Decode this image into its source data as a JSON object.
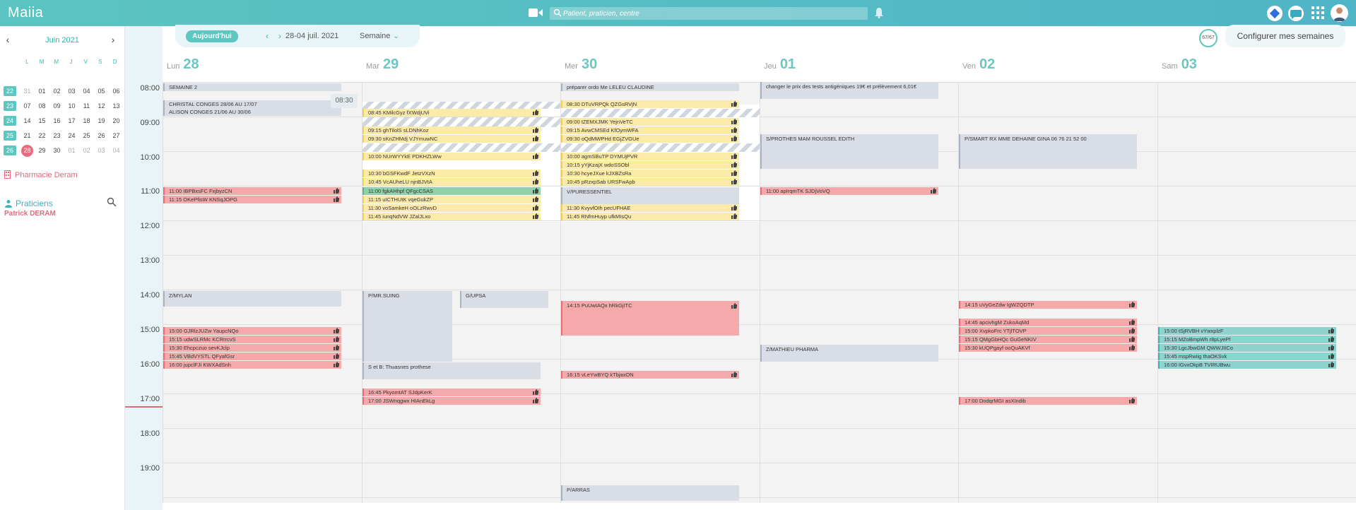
{
  "app": {
    "title": "Maiia"
  },
  "search": {
    "placeholder": "Patient, praticien, centre"
  },
  "mini_calendar": {
    "month": "Juin 2021",
    "dow": [
      "L",
      "M",
      "M",
      "J",
      "V",
      "S",
      "D"
    ],
    "weeks": [
      {
        "num": "22",
        "days": [
          "31",
          "01",
          "02",
          "03",
          "04",
          "05",
          "06"
        ]
      },
      {
        "num": "23",
        "days": [
          "07",
          "08",
          "09",
          "10",
          "11",
          "12",
          "13"
        ]
      },
      {
        "num": "24",
        "days": [
          "14",
          "15",
          "16",
          "17",
          "18",
          "19",
          "20"
        ]
      },
      {
        "num": "25",
        "days": [
          "21",
          "22",
          "23",
          "24",
          "25",
          "26",
          "27"
        ]
      },
      {
        "num": "26",
        "days": [
          "28",
          "29",
          "30",
          "01",
          "02",
          "03",
          "04"
        ]
      }
    ]
  },
  "sidebar": {
    "pharmacy": "Pharmacie Deram",
    "practitioners_title": "Praticiens",
    "practitioner": "Patrick DERAM"
  },
  "toolbar": {
    "today": "Aujourd'hui",
    "date_range": "28-04 juil. 2021",
    "view": "Semaine",
    "counter": "67/67",
    "configure": "Configurer mes semaines"
  },
  "tooltip": "08:30",
  "days": [
    {
      "label": "Lun",
      "num": "28"
    },
    {
      "label": "Mar",
      "num": "29"
    },
    {
      "label": "Mer",
      "num": "30"
    },
    {
      "label": "Jeu",
      "num": "01"
    },
    {
      "label": "Ven",
      "num": "02"
    },
    {
      "label": "Sam",
      "num": "03"
    }
  ],
  "hours": [
    "08:00",
    "09:00",
    "10:00",
    "11:00",
    "12:00",
    "13:00",
    "14:00",
    "15:00",
    "16:00",
    "17:00",
    "18:00",
    "19:00"
  ],
  "events": {
    "mon": [
      {
        "t": "SEMAINE 2"
      },
      {
        "t": "CHRISTAL CONGES 28/06 AU 17/07"
      },
      {
        "t": "ALISON CONGES 21/06 AU 30/06"
      },
      {
        "t": "11:00 IBPBxsFC FxjbyzCN"
      },
      {
        "t": "11:15 OKePfisW KNSqJOPG"
      },
      {
        "t": "Z/MYLAN"
      },
      {
        "t": "15:00 GJRlzJUZw YaupcNQo"
      },
      {
        "t": "15:15 udwSLRMc KCRrrcvS"
      },
      {
        "t": "15:30 Ehcpczuo sevKJclp"
      },
      {
        "t": "15:45 VBdVYSTL QFyafGsr"
      },
      {
        "t": "16:00 jupclFJi KWXAdSnh"
      }
    ],
    "tue": [
      {
        "t": "08:45 KMilcGyz fXWdjUVi"
      },
      {
        "t": "09:15 ghTilolS sLDNhKoz"
      },
      {
        "t": "09:30 sKnZHMdj VJYmuwNC"
      },
      {
        "t": "10:00 NUrWYYkE PDKHZLWw"
      },
      {
        "t": "10:30 bGSFKwdF JetzVXzN"
      },
      {
        "t": "10:45 VcAUheLU njnBJVtA"
      },
      {
        "t": "11:00 fgkAHhpf QFgcCSAS"
      },
      {
        "t": "11:15 uICTHUtK vqeGukZP"
      },
      {
        "t": "11:30 voSamkeH oOLzRwvD"
      },
      {
        "t": "11:45 iunqNdVW JZalJLxo"
      },
      {
        "t": "P/MR.SUING"
      },
      {
        "t": "G/UPSA"
      },
      {
        "t": "S et B: Thuasnes prothese"
      },
      {
        "t": "16:45 PkyomtAT SJdpKerK"
      },
      {
        "t": "17:00 JSWnqgwx HIAnEkLg"
      }
    ],
    "wed": [
      {
        "t": "préparer ordo Me LELEU CLAUDINE"
      },
      {
        "t": "08:30 DTuVRPQk QZGsRVjN"
      },
      {
        "t": "09:00 tZEMXJMK YejnVeTC"
      },
      {
        "t": "09:15 AvwCMSEd KfOymWFA"
      },
      {
        "t": "09:30 oQdMWPHd EGjZVGUe"
      },
      {
        "t": "10:00 agmSBuTP DYMUjPVR"
      },
      {
        "t": "10:15 yYjKzajX wdoSSObl"
      },
      {
        "t": "10:30 hcyeJXue kJXBZsRa"
      },
      {
        "t": "10:45 pRzxpSab URSFwApb"
      },
      {
        "t": "V/PURESSENTIEL"
      },
      {
        "t": "11:30 KvyvfOIh pecUFHAE"
      },
      {
        "t": "11:45 RNfmHuyp ufkMIsQu"
      },
      {
        "t": "14:15 PuUwIAQx hRkGjITC"
      },
      {
        "t": "16:15 vLeYwBYQ kTbjaxON"
      },
      {
        "t": "P/ARRAS"
      }
    ],
    "thu": [
      {
        "t": "changer le prix des tests antigéniques 19€ et prélèvement 6,01€"
      },
      {
        "t": "S/PROTHES MAM ROUSSEL EDITH"
      },
      {
        "t": "11:00 apIrqmTK SJDjVoVQ"
      },
      {
        "t": "Z/MATHIEU PHARMA"
      }
    ],
    "fri": [
      {
        "t": "P/SMART RX MME DEHAINE GINA 06 76 21 52 00"
      },
      {
        "t": "14:15 uVyGeZdw IgWZQDTP"
      },
      {
        "t": "14:45 apcivhgM ZukoAqMd"
      },
      {
        "t": "15:00 XvpkoFrc YTjlTOVP"
      },
      {
        "t": "15:15 QMgGbHQc GuGeNKIV"
      },
      {
        "t": "15:30 kUQPgayf ooQuAKVf"
      },
      {
        "t": "17:00 DodqrMGI asXIndib"
      }
    ],
    "sat": [
      {
        "t": "15:00 tSjRVBH vYwxplzF"
      },
      {
        "t": "15:15 MZoBmpWh r8pLyePf"
      },
      {
        "t": "15:30 LgcJbwGM QWWJIICo"
      },
      {
        "t": "15:45 mspRwiig thaOKSvk"
      },
      {
        "t": "16:00 IGvxOkpB TVIRUBwu"
      }
    ]
  }
}
